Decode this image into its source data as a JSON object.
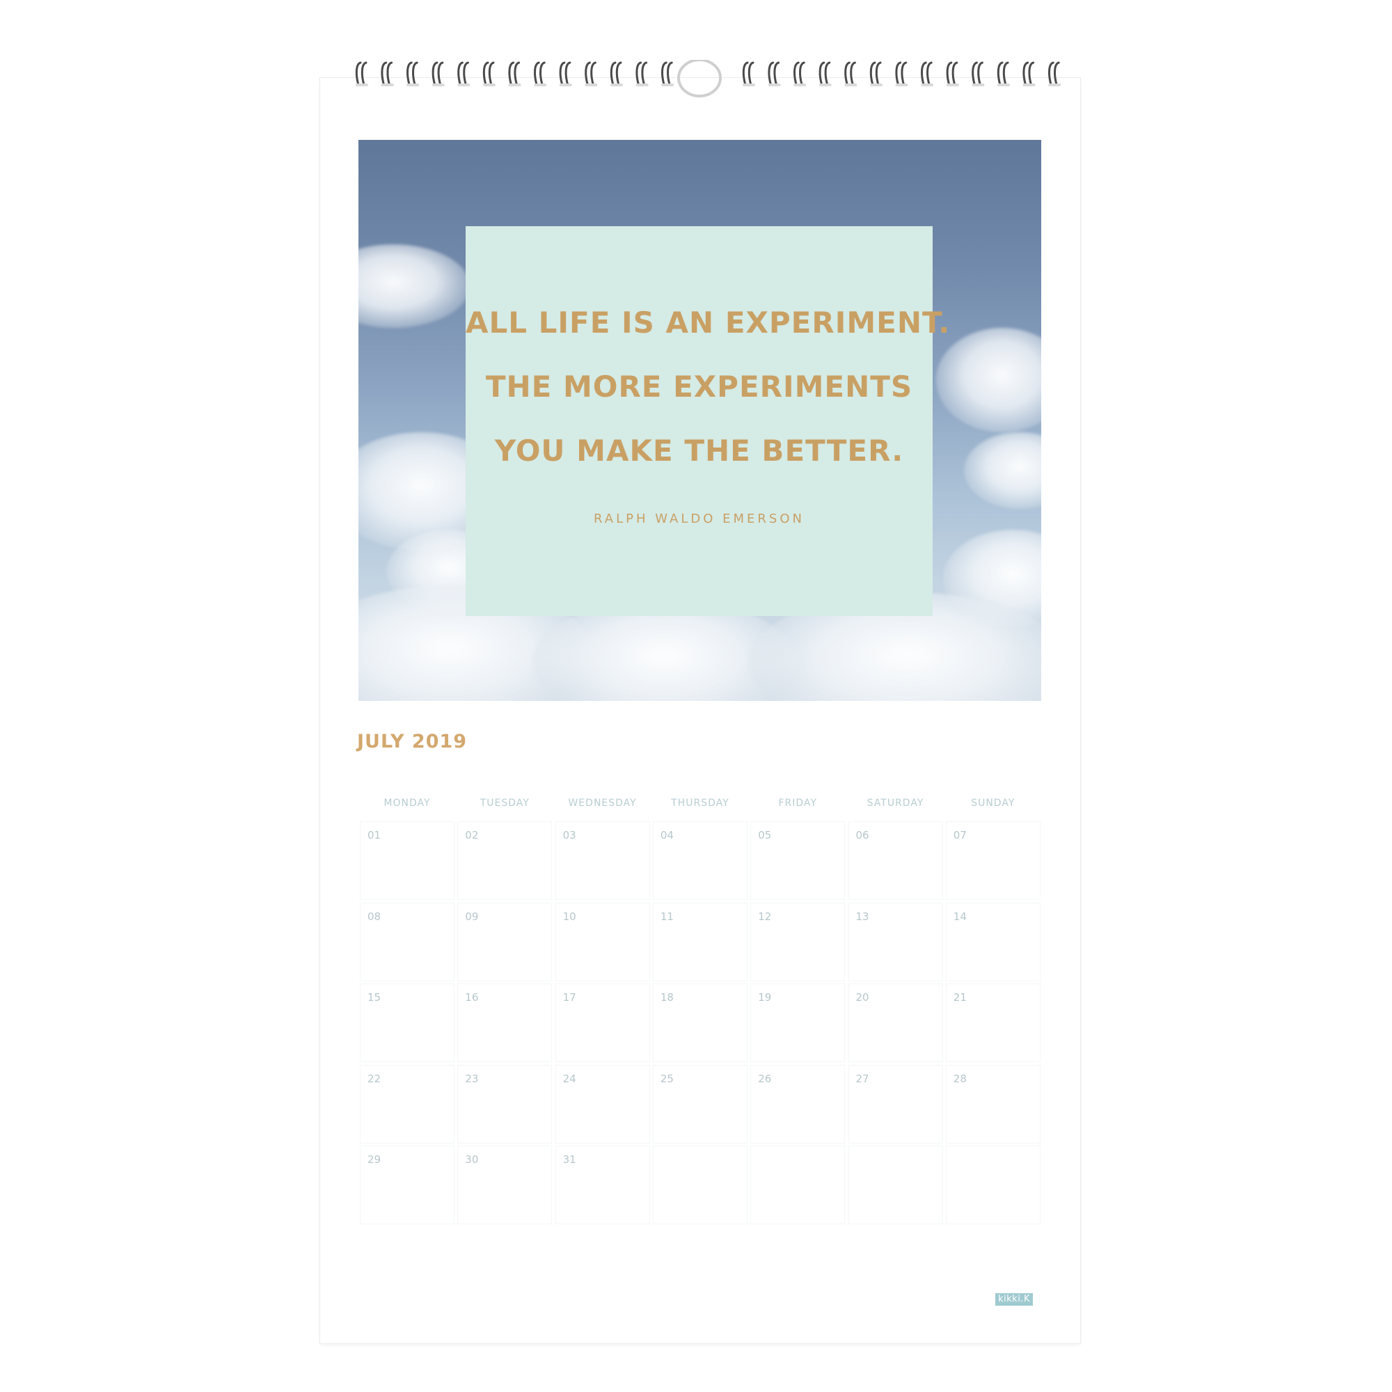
{
  "quote": {
    "lines": [
      "ALL LIFE IS AN EXPERIMENT.",
      "THE MORE EXPERIMENTS",
      "YOU MAKE THE BETTER."
    ],
    "author": "RALPH WALDO EMERSON"
  },
  "calendar": {
    "month_title": "JULY 2019",
    "weekdays": [
      "MONDAY",
      "TUESDAY",
      "WEDNESDAY",
      "THURSDAY",
      "FRIDAY",
      "SATURDAY",
      "SUNDAY"
    ],
    "weeks": [
      [
        "01",
        "02",
        "03",
        "04",
        "05",
        "06",
        "07"
      ],
      [
        "08",
        "09",
        "10",
        "11",
        "12",
        "13",
        "14"
      ],
      [
        "15",
        "16",
        "17",
        "18",
        "19",
        "20",
        "21"
      ],
      [
        "22",
        "23",
        "24",
        "25",
        "26",
        "27",
        "28"
      ],
      [
        "29",
        "30",
        "31",
        "",
        "",
        "",
        ""
      ]
    ]
  },
  "brand": {
    "logo_text": "kikki.K"
  },
  "colors": {
    "gold_text": "#c9a064",
    "quote_card": "#d5ebe6",
    "muted_text": "#b6c7cb",
    "brand_bg": "#9fcad0"
  }
}
